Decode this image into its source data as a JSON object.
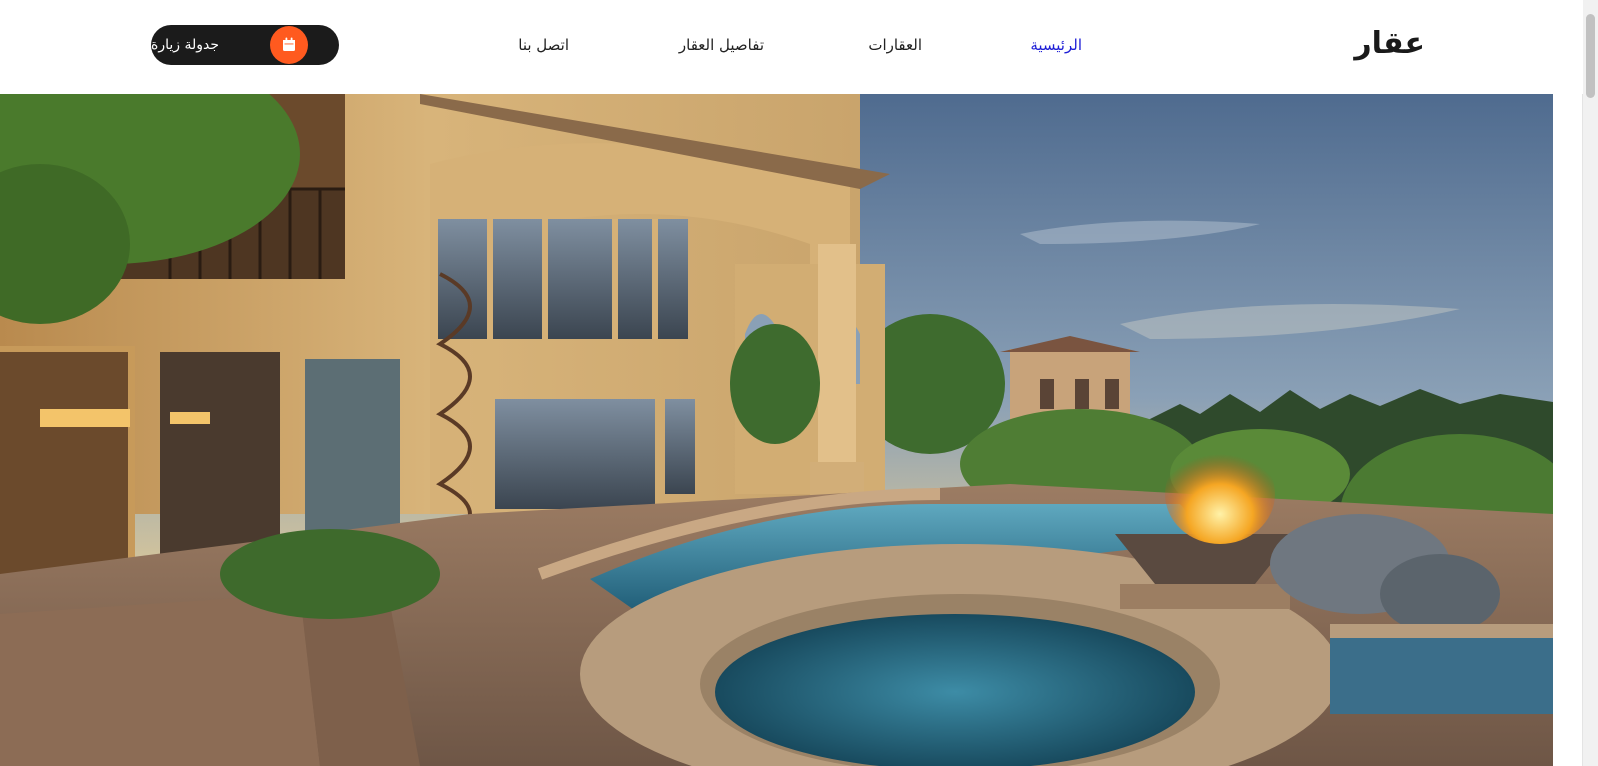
{
  "brand": {
    "logo_text": "عقار"
  },
  "nav": {
    "home": "الرئيسية",
    "properties": "العقارات",
    "property_details": "تفاصيل العقار",
    "contact": "اتصل بنا"
  },
  "cta": {
    "label": "جدولة زيارة",
    "icon": "calendar-icon"
  },
  "colors": {
    "active_link": "#1d1dd6",
    "cta_background": "#1b1b1b",
    "cta_icon_background": "#ff5a1f"
  },
  "hero": {
    "image_subject": "luxury-house-with-pool-at-sunset"
  }
}
